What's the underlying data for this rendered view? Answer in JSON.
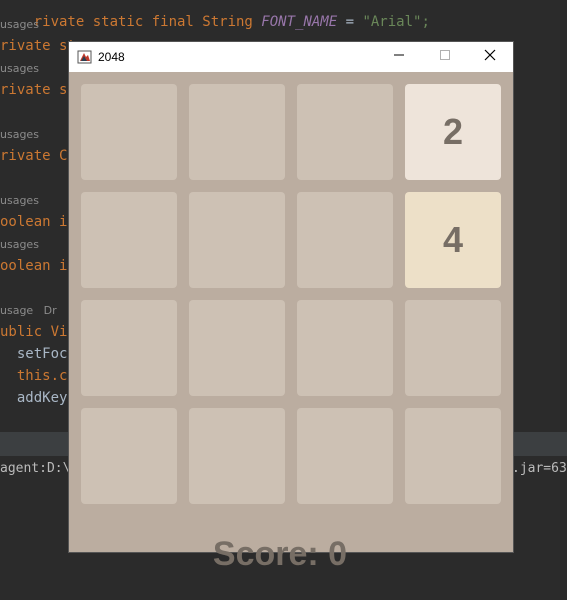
{
  "ide": {
    "lines": [
      {
        "a": "rivate static final String ",
        "b": "FONT_NAME",
        "c": " = ",
        "d": "\"Arial\";"
      },
      {
        "hint": "usages"
      },
      {
        "text": "rivate st"
      },
      {
        "hint": "usages"
      },
      {
        "text": "rivate st"
      },
      {
        "hint": "usages"
      },
      {
        "text": "rivate Co"
      },
      {
        "hint": "usages"
      },
      {
        "text": "oolean is"
      },
      {
        "hint": "usages"
      },
      {
        "text": "oolean is"
      },
      {
        "hint": "usage   Dr"
      },
      {
        "text": "ublic Vie"
      },
      {
        "text": "  setFoc"
      },
      {
        "text": "  this.c"
      },
      {
        "text": "  addKey"
      }
    ],
    "console_left": "agent:D:\\",
    "console_right": ".jar=63"
  },
  "window": {
    "title": "2048",
    "minimize_icon": "minimize-icon",
    "maximize_icon": "maximize-icon",
    "close_icon": "close-icon"
  },
  "game": {
    "tiles": [
      [
        "",
        "",
        "",
        "2"
      ],
      [
        "",
        "",
        "",
        "4"
      ],
      [
        "",
        "",
        "",
        ""
      ],
      [
        "",
        "",
        "",
        ""
      ]
    ],
    "tile_colors": {
      "empty": "#cdc1b4",
      "2": "#eee4da",
      "4": "#ede0c8"
    },
    "board_color": "#bbada0",
    "text_color": "#776e65",
    "score_text": "Score: 0"
  }
}
